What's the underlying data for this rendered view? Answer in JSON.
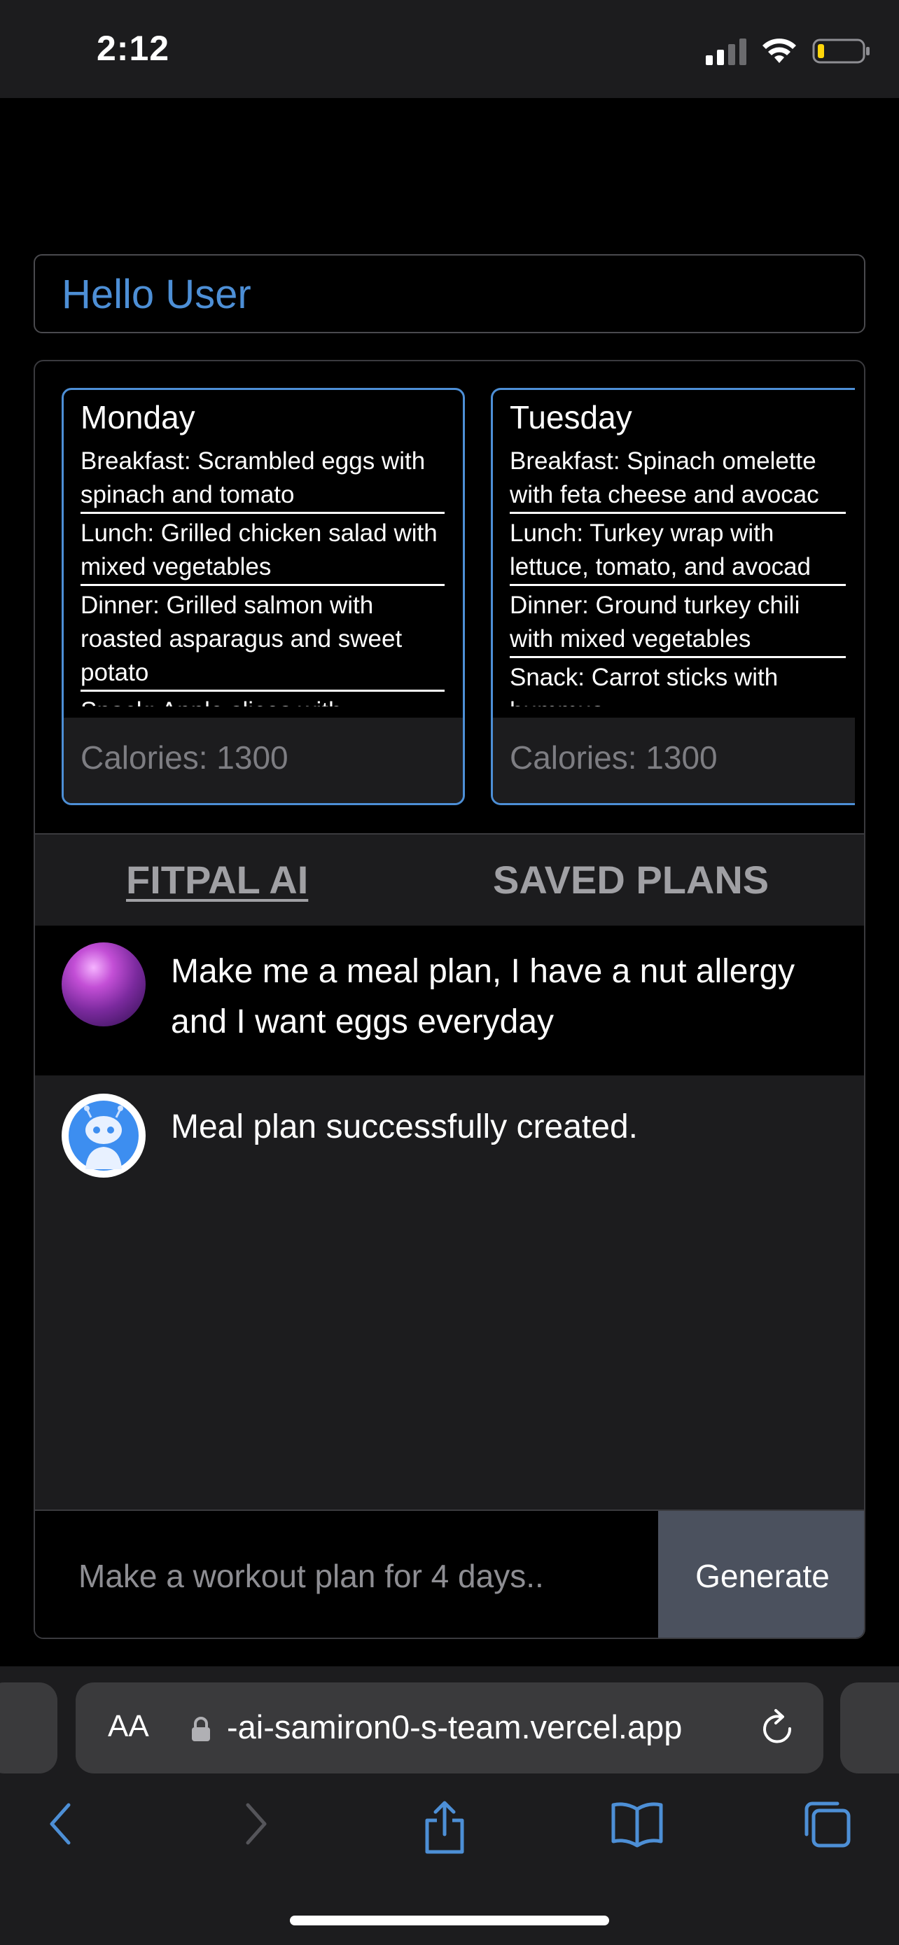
{
  "status_bar": {
    "time": "2:12"
  },
  "greeting": "Hello User",
  "plans": [
    {
      "day": "Monday",
      "meals": [
        "Breakfast: Scrambled eggs with spinach and tomato",
        "Lunch: Grilled chicken salad with mixed vegetables",
        "Dinner: Grilled salmon with roasted asparagus and sweet potato",
        "Snack: Apple slices with"
      ],
      "calories": "Calories: 1300"
    },
    {
      "day": "Tuesday",
      "meals": [
        "Breakfast: Spinach omelette",
        "with feta cheese and avocac",
        "Lunch: Turkey wrap with",
        "lettuce, tomato, and avocad",
        "Dinner: Ground turkey chili",
        "with mixed vegetables",
        "Snack: Carrot sticks with",
        "hummus"
      ],
      "calories": "Calories: 1300"
    }
  ],
  "tabs": {
    "fitpal": "FITPAL AI",
    "saved": "SAVED PLANS"
  },
  "chat": {
    "user_message": "Make me a meal plan, I have a nut allergy and I want eggs everyday",
    "bot_message": "Meal plan successfully created."
  },
  "input": {
    "placeholder": "Make a workout plan for 4 days..",
    "button": "Generate"
  },
  "browser": {
    "aa_label": "AA",
    "url": "-ai-samiron0-s-team.vercel.app"
  },
  "colors": {
    "accent": "#4d8fd6",
    "panel": "#1c1c1e",
    "button": "#4b515e"
  }
}
